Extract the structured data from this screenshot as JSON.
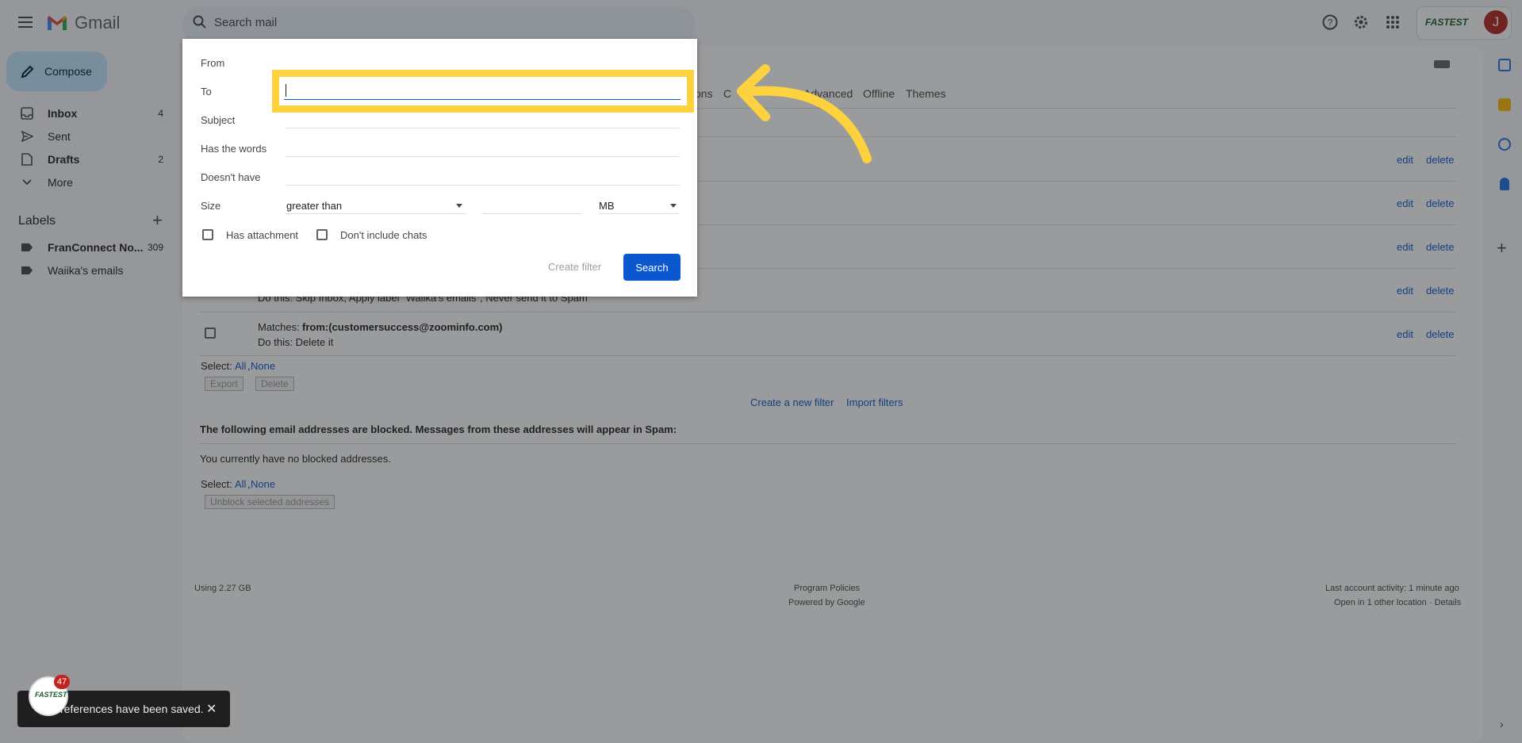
{
  "app": {
    "name": "Gmail"
  },
  "search": {
    "placeholder": "Search mail"
  },
  "brand": {
    "badge_text": "FASTEST",
    "avatar_letter": "J",
    "colors": {
      "accent": "#0b57d0",
      "highlight": "#fdd23e"
    }
  },
  "sidebar": {
    "compose": "Compose",
    "items": [
      {
        "label": "Inbox",
        "count": "4",
        "icon": "inbox-icon"
      },
      {
        "label": "Sent",
        "count": "",
        "icon": "send-icon"
      },
      {
        "label": "Drafts",
        "count": "2",
        "icon": "draft-icon"
      },
      {
        "label": "More",
        "count": "",
        "icon": "chevron-down-icon"
      }
    ],
    "labels_title": "Labels",
    "labels": [
      {
        "label": "FranConnect No...",
        "count": "309"
      },
      {
        "label": "Waiika's emails",
        "count": ""
      }
    ]
  },
  "settings": {
    "tabs": [
      "ons",
      "C",
      "Advanced",
      "Offline",
      "Themes"
    ],
    "filters": [
      {
        "partial_action": "Do this: Skip Inbox, Apply label \"Waiika's emails\", Never send it to Spam"
      },
      {
        "matches_label": "Matches:",
        "matches_value": "from:(customersuccess@zoominfo.com)",
        "action": "Do this: Delete it"
      }
    ],
    "edit": "edit",
    "delete": "delete",
    "select_label": "Select:",
    "select_all": "All",
    "select_none": "None",
    "export": "Export",
    "delete_btn": "Delete",
    "create_filter_link": "Create a new filter",
    "import_filters": "Import filters",
    "blocked_heading": "The following email addresses are blocked. Messages from these addresses will appear in Spam:",
    "no_blocked": "You currently have no blocked addresses.",
    "unblock": "Unblock selected addresses"
  },
  "footer": {
    "storage": "Using 2.27 GB",
    "policies": "Program Policies",
    "powered": "Powered by Google",
    "activity": "Last account activity: 1 minute ago",
    "open_in": "Open in 1 other location · Details"
  },
  "dialog": {
    "from": "From",
    "to": "To",
    "subject": "Subject",
    "has_words": "Has the words",
    "doesnt_have": "Doesn't have",
    "size": "Size",
    "size_op": "greater than",
    "size_unit": "MB",
    "has_attachment": "Has attachment",
    "dont_include_chats": "Don't include chats",
    "create_filter": "Create filter",
    "search": "Search"
  },
  "toast": {
    "message": "references have been saved.",
    "badge_count": "47"
  }
}
